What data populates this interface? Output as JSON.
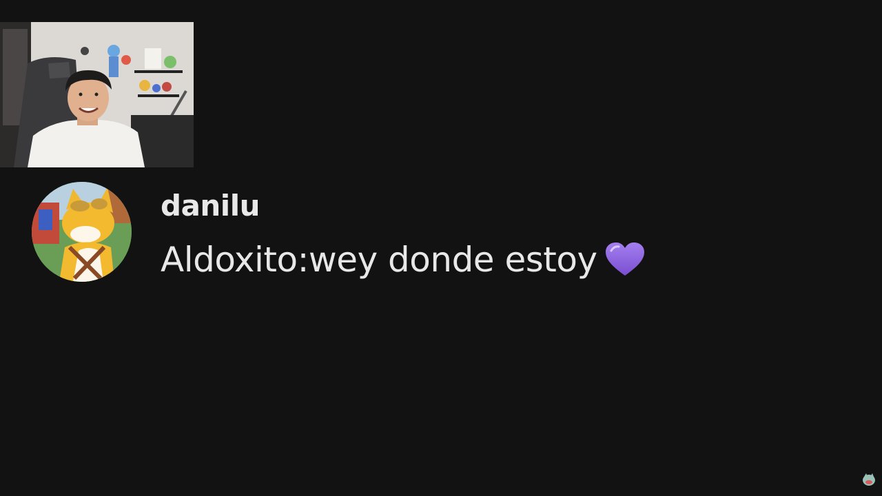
{
  "comment": {
    "username": "danilu",
    "message": "Aldoxito:wey donde estoy"
  },
  "icons": {
    "heart": "purple-heart-icon",
    "corner": "channel-logo-icon"
  },
  "colors": {
    "background": "#121212",
    "text": "#e8e8e8",
    "heart": "#8a5cd6"
  }
}
